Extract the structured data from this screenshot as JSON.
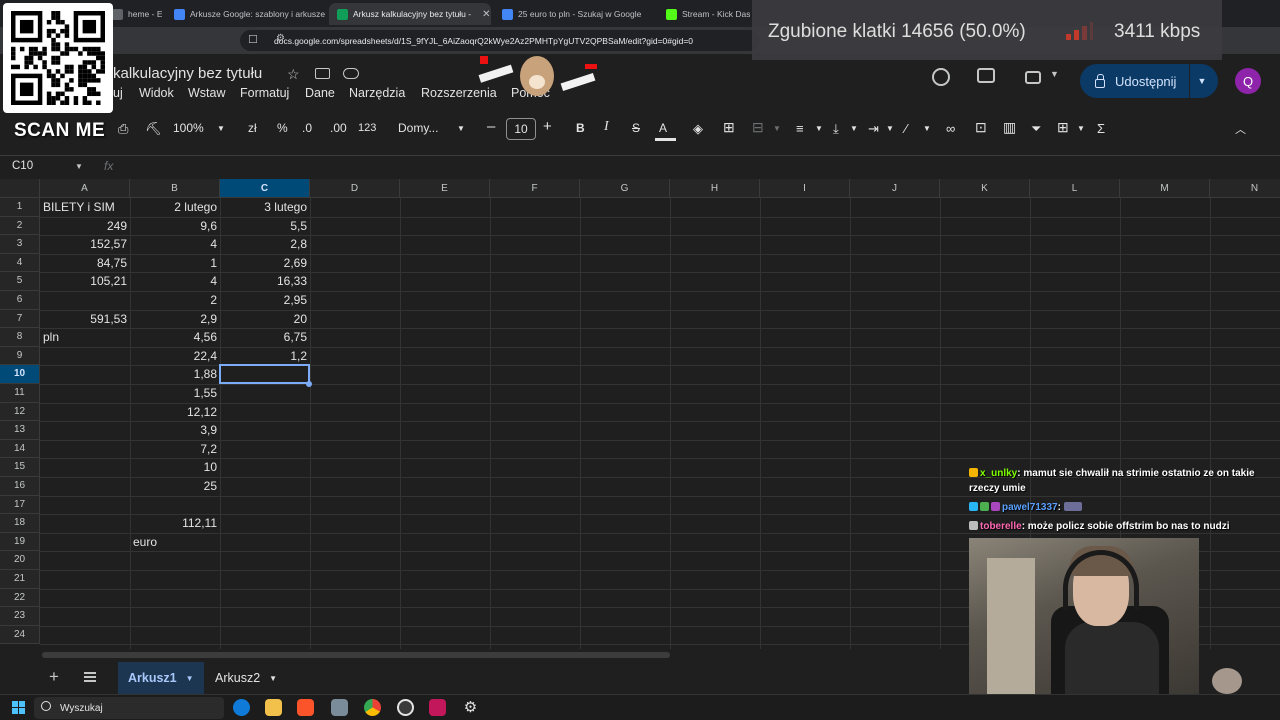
{
  "browser": {
    "tabs": [
      {
        "title": "heme - Ex",
        "icon": "tab-icon",
        "color": "#5f6368"
      },
      {
        "title": "Arkusze Google: szablony i arkusze k",
        "icon": "google-icon",
        "color": "#4285f4"
      },
      {
        "title": "Arkusz kalkulacyjny bez tytułu -",
        "icon": "sheets-icon",
        "color": "#0f9d58"
      },
      {
        "title": "25 euro to pln - Szukaj w Google",
        "icon": "google-icon",
        "color": "#4285f4"
      },
      {
        "title": "Stream - Kick Dashb",
        "icon": "kick-icon",
        "color": "#53fc18"
      }
    ],
    "url": "docs.google.com/spreadsheets/d/1S_9fYJL_6AiZaoqrQ2kWye2Az2PMHTpYgUTV2QPBSaM/edit?gid=0#gid=0"
  },
  "app": {
    "title": "kalkulacyjny bez tytułu",
    "menu": [
      "uj",
      "Widok",
      "Wstaw",
      "Formatuj",
      "Dane",
      "Narzędzia",
      "Rozszerzenia",
      "Pomoc"
    ],
    "share_label": "Udostępnij",
    "avatar_letter": "Q"
  },
  "toolbar": {
    "zoom": "100%",
    "currency": "zł",
    "percent": "%",
    "dec_less": ".0",
    "dec_more": ".00",
    "numfmt": "123",
    "font": "Domy...",
    "font_size": "10",
    "bold": "B",
    "italic": "I",
    "strike": "S",
    "text_color": "A",
    "fn": "Σ"
  },
  "formula_bar": {
    "namebox": "C10",
    "fx": "fx"
  },
  "grid": {
    "columns": [
      "A",
      "B",
      "C",
      "D",
      "E",
      "F",
      "G",
      "H",
      "I",
      "J",
      "K",
      "L",
      "M",
      "N"
    ],
    "selected_column": "C",
    "selected_row": 10,
    "rows": [
      "1",
      "2",
      "3",
      "4",
      "5",
      "6",
      "7",
      "8",
      "9",
      "10",
      "11",
      "12",
      "13",
      "14",
      "15",
      "16",
      "17",
      "18",
      "19",
      "20",
      "21",
      "22",
      "23",
      "24"
    ],
    "cells": [
      {
        "row": 1,
        "col": "A",
        "value": "BILETY i SIM",
        "align": "left"
      },
      {
        "row": 1,
        "col": "B",
        "value": "2 lutego",
        "align": "right"
      },
      {
        "row": 1,
        "col": "C",
        "value": "3 lutego",
        "align": "right"
      },
      {
        "row": 2,
        "col": "A",
        "value": "249",
        "align": "right"
      },
      {
        "row": 2,
        "col": "B",
        "value": "9,6",
        "align": "right"
      },
      {
        "row": 2,
        "col": "C",
        "value": "5,5",
        "align": "right"
      },
      {
        "row": 3,
        "col": "A",
        "value": "152,57",
        "align": "right"
      },
      {
        "row": 3,
        "col": "B",
        "value": "4",
        "align": "right"
      },
      {
        "row": 3,
        "col": "C",
        "value": "2,8",
        "align": "right"
      },
      {
        "row": 4,
        "col": "A",
        "value": "84,75",
        "align": "right"
      },
      {
        "row": 4,
        "col": "B",
        "value": "1",
        "align": "right"
      },
      {
        "row": 4,
        "col": "C",
        "value": "2,69",
        "align": "right"
      },
      {
        "row": 5,
        "col": "A",
        "value": "105,21",
        "align": "right"
      },
      {
        "row": 5,
        "col": "B",
        "value": "4",
        "align": "right"
      },
      {
        "row": 5,
        "col": "C",
        "value": "16,33",
        "align": "right"
      },
      {
        "row": 6,
        "col": "B",
        "value": "2",
        "align": "right"
      },
      {
        "row": 6,
        "col": "C",
        "value": "2,95",
        "align": "right"
      },
      {
        "row": 7,
        "col": "A",
        "value": "591,53",
        "align": "right"
      },
      {
        "row": 7,
        "col": "B",
        "value": "2,9",
        "align": "right"
      },
      {
        "row": 7,
        "col": "C",
        "value": "20",
        "align": "right"
      },
      {
        "row": 8,
        "col": "A",
        "value": "pln",
        "align": "left"
      },
      {
        "row": 8,
        "col": "B",
        "value": "4,56",
        "align": "right"
      },
      {
        "row": 8,
        "col": "C",
        "value": "6,75",
        "align": "right"
      },
      {
        "row": 9,
        "col": "B",
        "value": "22,4",
        "align": "right"
      },
      {
        "row": 9,
        "col": "C",
        "value": "1,2",
        "align": "right"
      },
      {
        "row": 10,
        "col": "B",
        "value": "1,88",
        "align": "right"
      },
      {
        "row": 11,
        "col": "B",
        "value": "1,55",
        "align": "right"
      },
      {
        "row": 12,
        "col": "B",
        "value": "12,12",
        "align": "right"
      },
      {
        "row": 13,
        "col": "B",
        "value": "3,9",
        "align": "right"
      },
      {
        "row": 14,
        "col": "B",
        "value": "7,2",
        "align": "right"
      },
      {
        "row": 15,
        "col": "B",
        "value": "10",
        "align": "right"
      },
      {
        "row": 16,
        "col": "B",
        "value": "25",
        "align": "right"
      },
      {
        "row": 18,
        "col": "B",
        "value": "112,11",
        "align": "right"
      },
      {
        "row": 19,
        "col": "B",
        "value": "euro",
        "align": "left"
      }
    ]
  },
  "sheets": {
    "tabs": [
      "Arkusz1",
      "Arkusz2"
    ],
    "active": "Arkusz1"
  },
  "taskbar": {
    "search_placeholder": "Wyszukaj"
  },
  "overlays": {
    "scan_me": "SCAN ME",
    "dropped_frames": "Zgubione klatki 14656 (50.0%)",
    "bitrate": "3411 kbps",
    "chat": [
      {
        "user": "x_unlky",
        "user_color": "#7fff00",
        "text": "mamut sie chwalił na strimie ostatnio ze on takie rzeczy umie"
      },
      {
        "user": "pawel71337",
        "user_color": "#1e90ff",
        "text": ""
      },
      {
        "user": "toberelle",
        "user_color": "#ff69b4",
        "text": "może policz sobie offstrim bo nas to nudzi"
      }
    ]
  },
  "colors": {
    "accent": "#7cacf8",
    "share_bg": "#0b3a66",
    "avatar": "#8e24aa"
  }
}
